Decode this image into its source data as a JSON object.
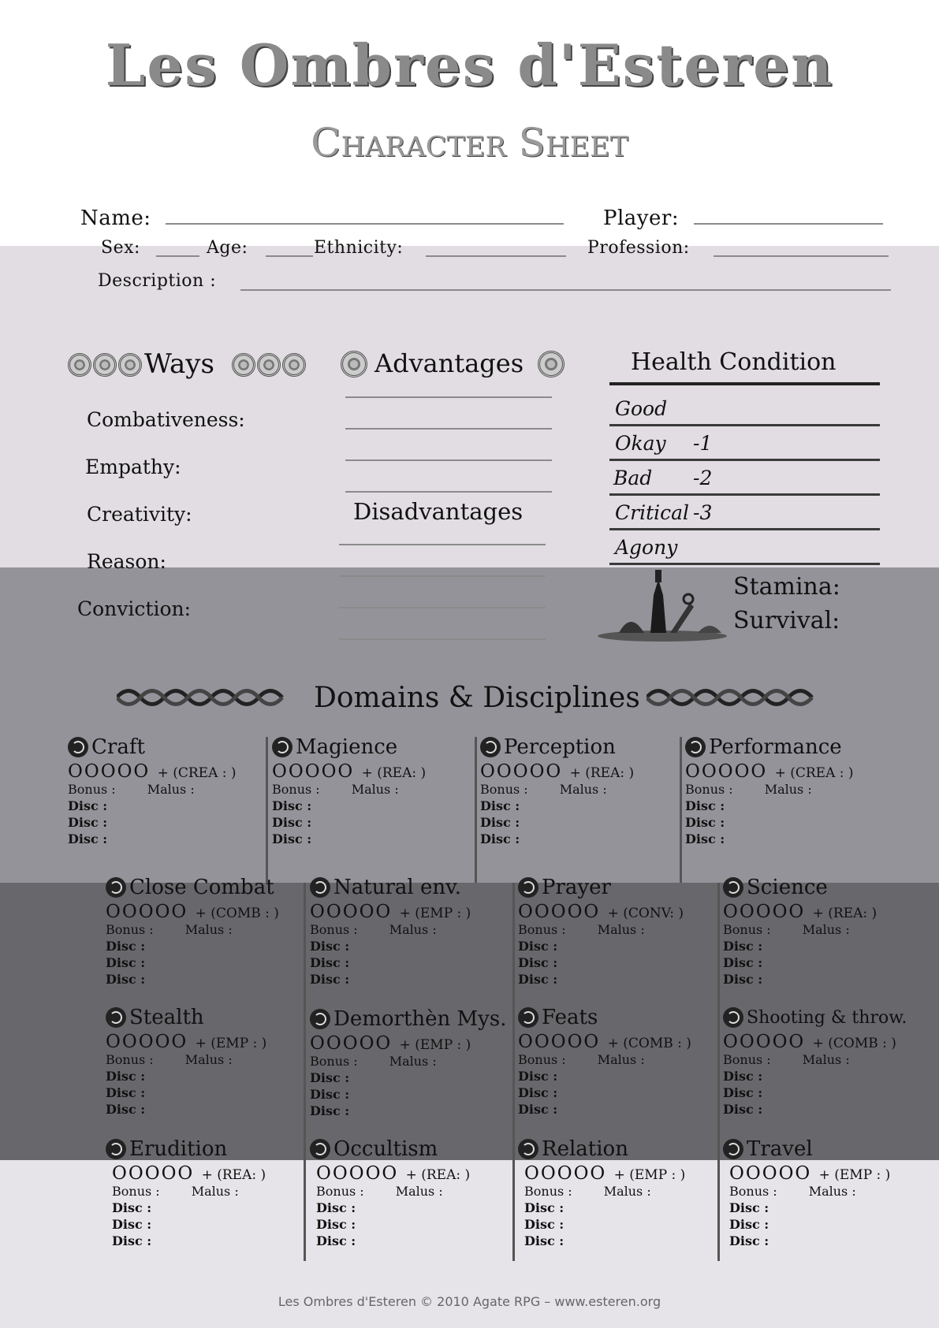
{
  "header": {
    "title_line1": "Les Ombres d'Esteren",
    "title_line2": "Character Sheet"
  },
  "identity": {
    "name_label": "Name:",
    "player_label": "Player:",
    "sex_label": "Sex:",
    "age_label": "Age:",
    "ethnicity_label": "Ethnicity:",
    "profession_label": "Profession:",
    "description_label": "Description :"
  },
  "ways": {
    "title": "Ways",
    "items": [
      "Combativeness:",
      "Empathy:",
      "Creativity:",
      "Reason:",
      "Conviction:"
    ]
  },
  "advantages": {
    "title": "Advantages",
    "disadvantages_title": "Disadvantages"
  },
  "health": {
    "title": "Health Condition",
    "rows": [
      {
        "label": "Good",
        "mod": ""
      },
      {
        "label": "Okay",
        "mod": "-1"
      },
      {
        "label": "Bad",
        "mod": "-2"
      },
      {
        "label": "Critical",
        "mod": "-3"
      },
      {
        "label": "Agony",
        "mod": ""
      }
    ],
    "stamina_label": "Stamina:",
    "survival_label": "Survival:"
  },
  "domains": {
    "title": "Domains & Disciplines",
    "circles": "OOOOO",
    "bonus_label": "Bonus :",
    "malus_label": "Malus :",
    "disc_label": "Disc :",
    "items": [
      {
        "name": "Craft",
        "way": "+ (CREA :      )"
      },
      {
        "name": "Magience",
        "way": "+ (REA:      )"
      },
      {
        "name": "Perception",
        "way": "+ (REA:      )"
      },
      {
        "name": "Performance",
        "way": "+ (CREA :      )"
      },
      {
        "name": "Close Combat",
        "way": "+ (COMB :      )"
      },
      {
        "name": "Natural env.",
        "way": "+ (EMP :      )"
      },
      {
        "name": "Prayer",
        "way": "+ (CONV:      )"
      },
      {
        "name": "Science",
        "way": "+ (REA:      )"
      },
      {
        "name": "Stealth",
        "way": "+ (EMP :      )"
      },
      {
        "name": "Demorthèn Mys.",
        "way": "+ (EMP :      )"
      },
      {
        "name": "Feats",
        "way": "+ (COMB :      )"
      },
      {
        "name": "Shooting & throw.",
        "way": "+ (COMB :      )"
      },
      {
        "name": "Erudition",
        "way": "+ (REA:      )"
      },
      {
        "name": "Occultism",
        "way": "+ (REA:      )"
      },
      {
        "name": "Relation",
        "way": "+ (EMP :      )"
      },
      {
        "name": "Travel",
        "way": "+ (EMP :      )"
      }
    ]
  },
  "footer": {
    "text": "Les Ombres d'Esteren © 2010 Agate RPG – www.esteren.org"
  }
}
